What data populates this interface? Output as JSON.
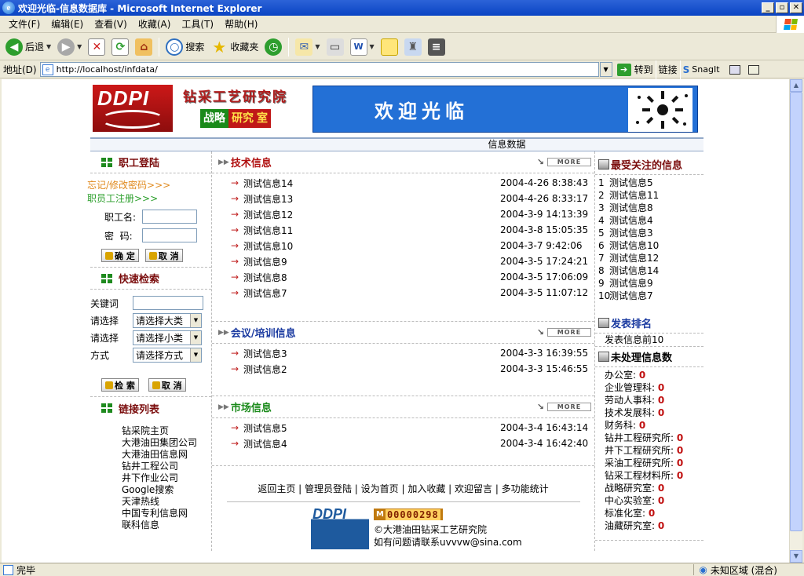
{
  "window": {
    "title": "欢迎光临-信息数据库 - Microsoft Internet Explorer"
  },
  "menu": [
    "文件(F)",
    "编辑(E)",
    "查看(V)",
    "收藏(A)",
    "工具(T)",
    "帮助(H)"
  ],
  "toolbar": {
    "back": "后退",
    "search": "搜索",
    "favorites": "收藏夹"
  },
  "address": {
    "label": "地址(D)",
    "url": "http://localhost/infdata/",
    "go": "转到",
    "links": "链接",
    "snagit": "SnagIt"
  },
  "status": {
    "left": "完毕",
    "right": "未知区域 (混合)"
  },
  "banner": {
    "logo": "DDPI",
    "institute": "钻采工艺研究院",
    "office_1": "战略",
    "office_2": "研究",
    "office_3": "室",
    "welcome": "欢迎光临"
  },
  "infobar": "信息数据",
  "login": {
    "title": "职工登陆",
    "forgot": "忘记/修改密码>>>",
    "register": "职员工注册>>>",
    "name_label": "职工名:",
    "pwd_label": "密  码:",
    "ok": "确 定",
    "cancel": "取 消"
  },
  "search": {
    "title": "快速检索",
    "keyword_label": "关键词",
    "select1_label": "请选择",
    "select1_value": "请选择大类",
    "select2_label": "请选择",
    "select2_value": "请选择小类",
    "select3_label": "方式",
    "select3_value": "请选择方式",
    "search_btn": "检 索",
    "cancel_btn": "取 消"
  },
  "links_list": {
    "title": "链接列表",
    "items": [
      "钻采院主页",
      "大港油田集团公司",
      "大港油田信息网",
      "钻井工程公司",
      "井下作业公司",
      "Google搜索",
      "天津热线",
      "中国专利信息网",
      "联科信息"
    ]
  },
  "tech": {
    "title": "技术信息",
    "more": "MORE",
    "items": [
      {
        "title": "测试信息14",
        "date": "2004-4-26 8:38:43"
      },
      {
        "title": "测试信息13",
        "date": "2004-4-26 8:33:17"
      },
      {
        "title": "测试信息12",
        "date": "2004-3-9 14:13:39"
      },
      {
        "title": "测试信息11",
        "date": "2004-3-8 15:05:35"
      },
      {
        "title": "测试信息10",
        "date": "2004-3-7 9:42:06"
      },
      {
        "title": "测试信息9",
        "date": "2004-3-5 17:24:21"
      },
      {
        "title": "测试信息8",
        "date": "2004-3-5 17:06:09"
      },
      {
        "title": "测试信息7",
        "date": "2004-3-5 11:07:12"
      }
    ]
  },
  "meeting": {
    "title": "会议/培训信息",
    "more": "MORE",
    "items": [
      {
        "title": "测试信息3",
        "date": "2004-3-3 16:39:55"
      },
      {
        "title": "测试信息2",
        "date": "2004-3-3 15:46:55"
      }
    ]
  },
  "market": {
    "title": "市场信息",
    "more": "MORE",
    "items": [
      {
        "title": "测试信息5",
        "date": "2004-3-4 16:43:14"
      },
      {
        "title": "测试信息4",
        "date": "2004-3-4 16:42:40"
      }
    ]
  },
  "footer": {
    "links": "返回主页 | 管理员登陆 | 设为首页 | 加入收藏 | 欢迎留言 | 多功能统计",
    "logo": "DDPI",
    "counter": "00000298",
    "copyright": "©大港油田钻采工艺研究院",
    "contact": "如有问题请联系uvvvw@sina.com"
  },
  "popular": {
    "title": "最受关注的信息",
    "items": [
      "测试信息5",
      "测试信息11",
      "测试信息8",
      "测试信息4",
      "测试信息3",
      "测试信息10",
      "测试信息12",
      "测试信息14",
      "测试信息9",
      "测试信息7"
    ]
  },
  "ranking": {
    "title": "发表排名",
    "item": "发表信息前10"
  },
  "pending": {
    "title": "未处理信息数",
    "items": [
      {
        "dept": "办公室:",
        "count": "0"
      },
      {
        "dept": "企业管理科:",
        "count": "0"
      },
      {
        "dept": "劳动人事科:",
        "count": "0"
      },
      {
        "dept": "技术发展科:",
        "count": "0"
      },
      {
        "dept": "财务科:",
        "count": "0"
      },
      {
        "dept": "钻井工程研究所:",
        "count": "0"
      },
      {
        "dept": "井下工程研究所:",
        "count": "0"
      },
      {
        "dept": "采油工程研究所:",
        "count": "0"
      },
      {
        "dept": "钻采工程材料所:",
        "count": "0"
      },
      {
        "dept": "战略研究室:",
        "count": "0"
      },
      {
        "dept": "中心实验室:",
        "count": "0"
      },
      {
        "dept": "标准化室:",
        "count": "0"
      },
      {
        "dept": "油藏研究室:",
        "count": "0"
      }
    ]
  }
}
